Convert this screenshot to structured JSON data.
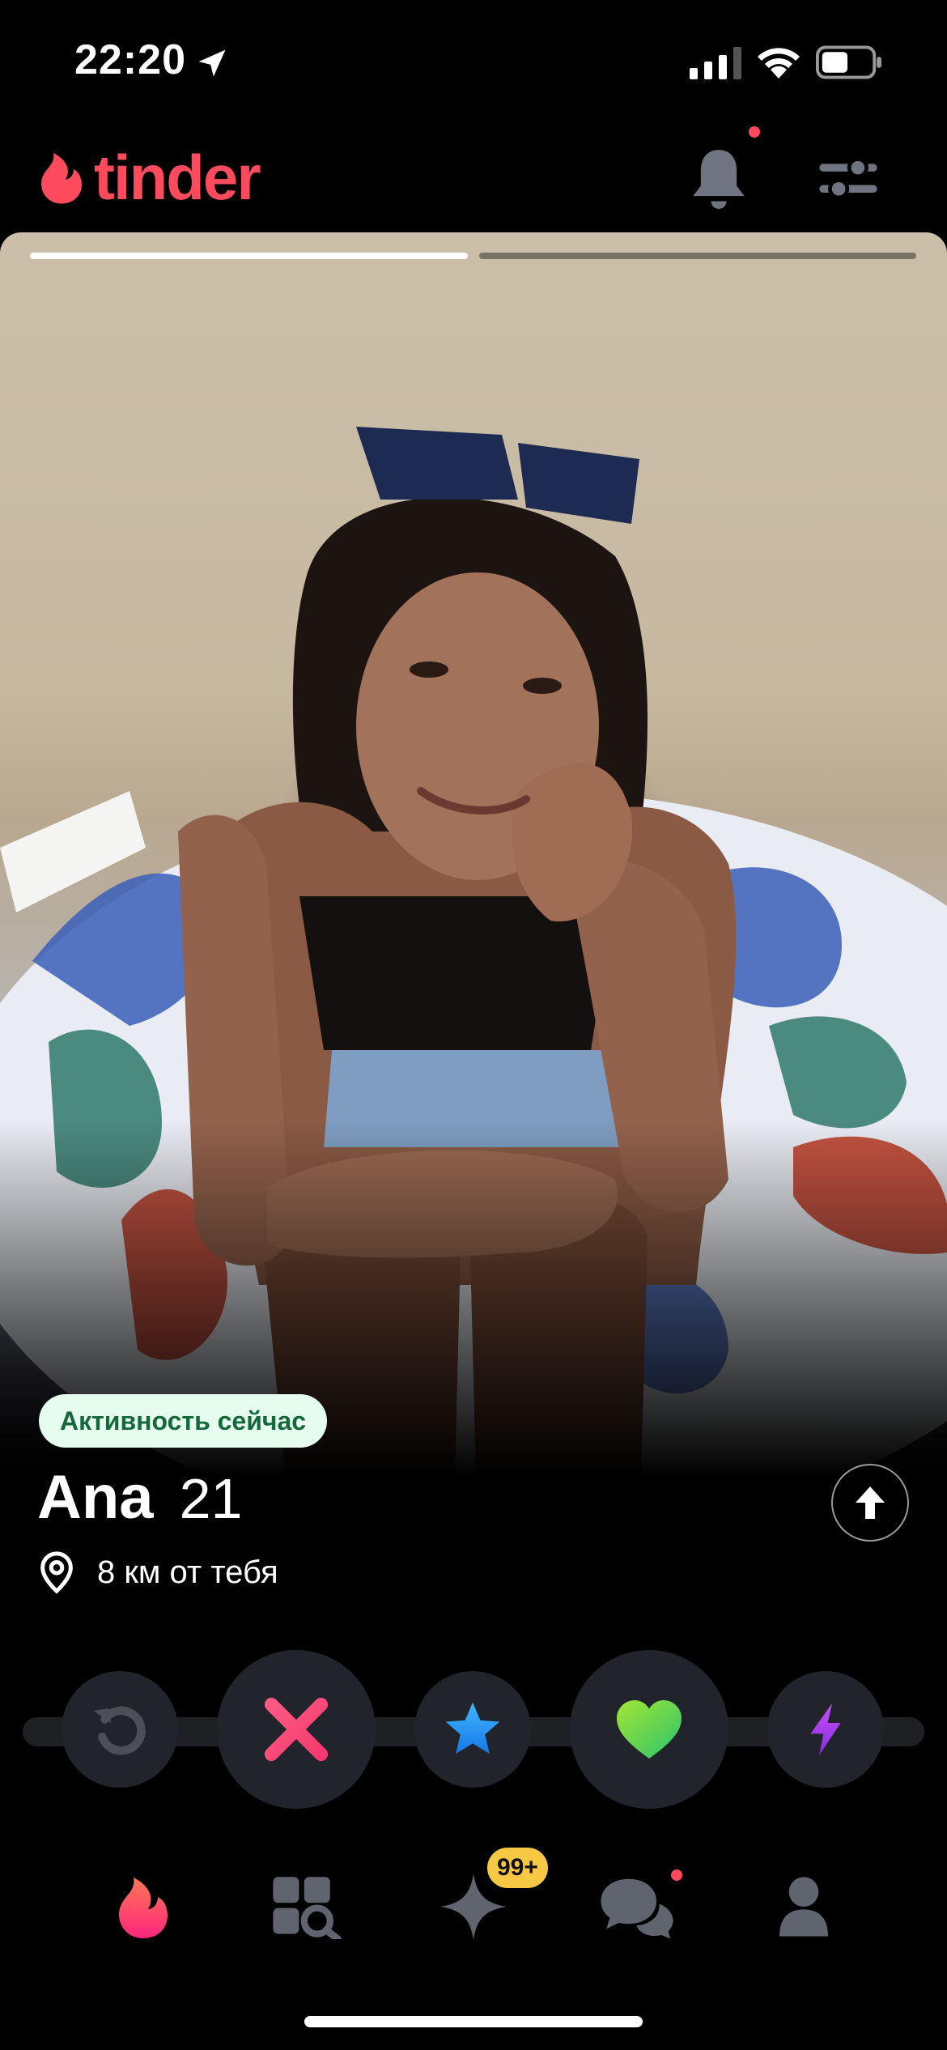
{
  "status_bar": {
    "time": "22:20"
  },
  "header": {
    "logo_text": "tinder"
  },
  "profile": {
    "activity_badge": "Активность сейчас",
    "name": "Ana",
    "age": "21",
    "distance": "8 км от тебя",
    "photo_count": 2,
    "current_photo": 1
  },
  "actions": [
    "rewind-icon",
    "nope-icon",
    "super-like-icon",
    "like-icon",
    "boost-icon"
  ],
  "nav": {
    "items": [
      "flame-icon",
      "explore-icon",
      "gold-spark-icon",
      "chat-icon",
      "profile-icon"
    ],
    "likes_badge": "99+"
  },
  "colors": {
    "brand": "#fd4a5c",
    "activity_bg": "#e5fcee",
    "activity_text": "#15683b",
    "badge_gold": "#f7c844"
  }
}
